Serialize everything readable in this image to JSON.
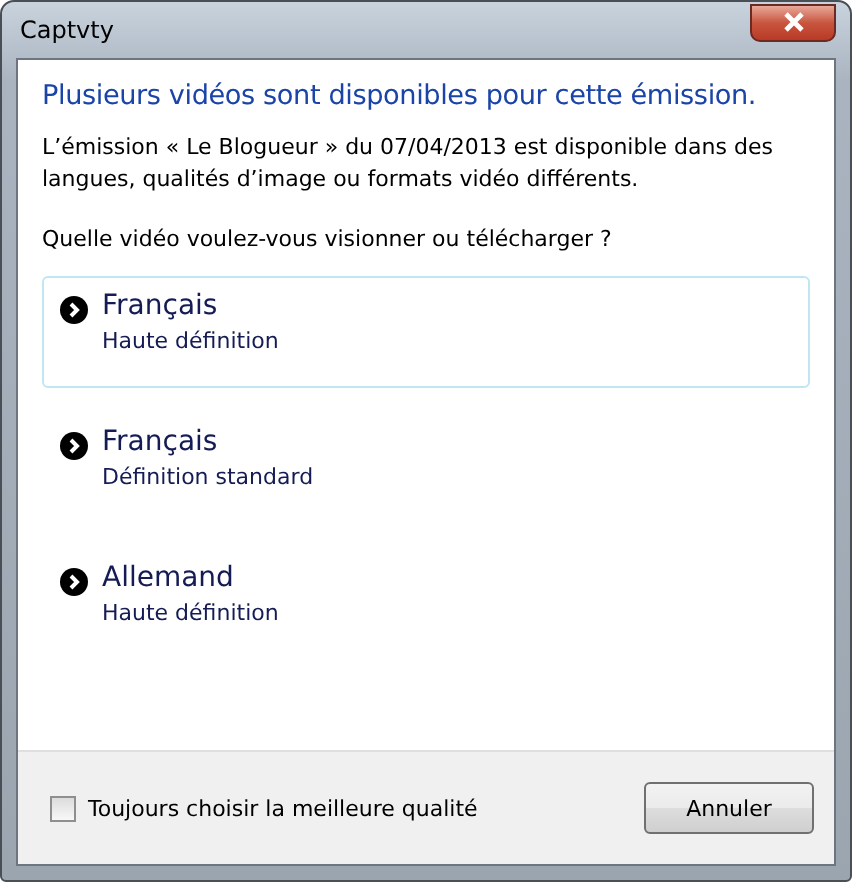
{
  "window": {
    "title": "Captvty"
  },
  "heading": "Plusieurs vidéos sont disponibles pour cette émission.",
  "description": "L’émission « Le Blogueur » du 07/04/2013 est disponible dans des langues, qualités d’image ou formats vidéo différents.",
  "question": "Quelle vidéo voulez-vous visionner ou télécharger ?",
  "options": [
    {
      "title": "Français",
      "subtitle": "Haute définition",
      "selected": true
    },
    {
      "title": "Français",
      "subtitle": "Définition standard",
      "selected": false
    },
    {
      "title": "Allemand",
      "subtitle": "Haute définition",
      "selected": false
    }
  ],
  "footer": {
    "checkbox": {
      "label": "Toujours choisir la meilleure qualité",
      "checked": false
    },
    "buttons": [
      "Annuler"
    ]
  }
}
